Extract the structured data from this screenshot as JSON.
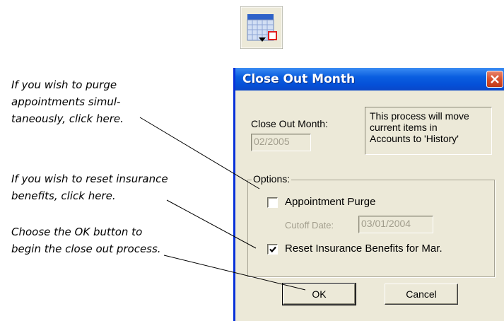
{
  "callouts": {
    "purge": [
      "If you wish to purge",
      "appointments simul-",
      "taneously, click here."
    ],
    "reset": [
      "If you wish to reset insurance",
      "benefits, click here."
    ],
    "ok": [
      "Choose the OK button to",
      "begin the close out process."
    ]
  },
  "toolbar_icon": {
    "icon": "calendar-icon"
  },
  "dialog": {
    "title": "Close Out Month",
    "close_icon": "close-icon",
    "close_out_month_label": "Close Out Month:",
    "close_out_month_value": "02/2005",
    "info_lines": [
      "This process will move",
      "current items in",
      "Accounts to 'History'"
    ],
    "options_label": "Options:",
    "appointment_purge": {
      "label": "Appointment Purge",
      "checked": false
    },
    "cutoff_date_label": "Cutoff Date:",
    "cutoff_date_value": "03/01/2004",
    "reset_insurance": {
      "label": "Reset Insurance Benefits for Mar.",
      "checked": true
    },
    "ok_label": "OK",
    "cancel_label": "Cancel"
  },
  "colors": {
    "titlebar": "#0a5ee0",
    "dialog_bg": "#ece9d8",
    "close_button": "#d9502c",
    "disabled_text": "#a19d8c"
  }
}
